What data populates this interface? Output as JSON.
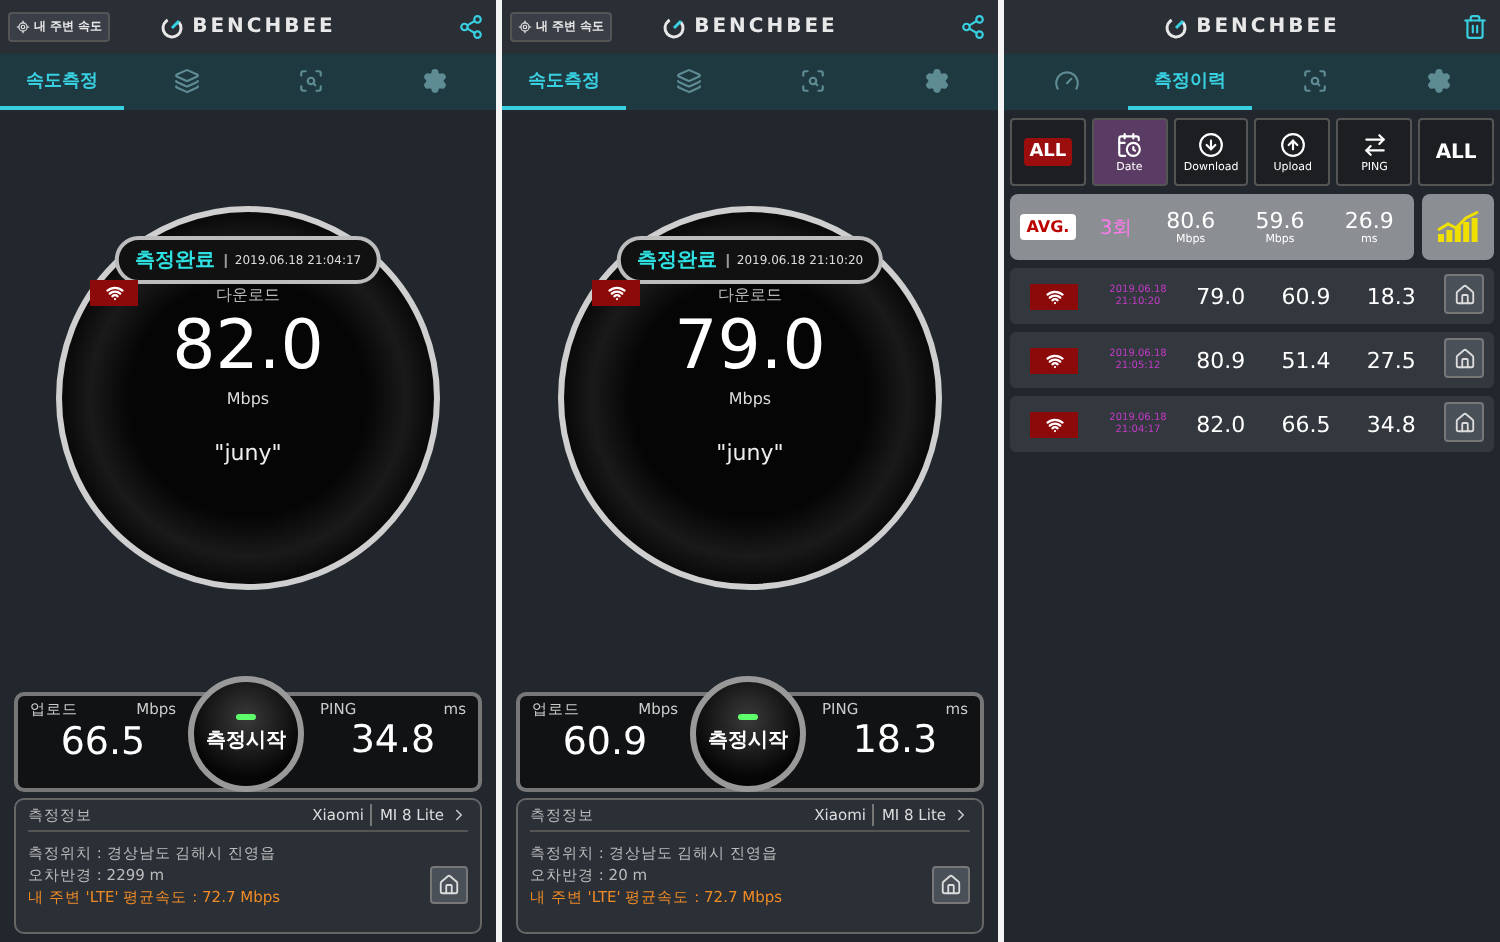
{
  "screens": [
    {
      "kind": "result",
      "header": {
        "nearby_button": "내 주변 속도",
        "logo": "BENCHBEE"
      },
      "tabs": [
        {
          "kind": "text",
          "label": "속도측정",
          "selected": true
        },
        {
          "kind": "layers",
          "selected": false
        },
        {
          "kind": "history",
          "selected": false
        },
        {
          "kind": "settings",
          "selected": false
        }
      ],
      "dial": {
        "status": "측정완료",
        "timestamp": "2019.06.18 21:04:17",
        "label": "다운로드",
        "value": "82.0",
        "unit": "Mbps",
        "network_name": "\"juny\""
      },
      "stats": {
        "upload_label": "업로드",
        "upload_unit": "Mbps",
        "upload_value": "66.5",
        "start_button": "측정시작",
        "ping_label": "PING",
        "ping_unit": "ms",
        "ping_value": "34.8"
      },
      "info": {
        "title": "측정정보",
        "brand": "Xiaomi",
        "model": "MI 8 Lite",
        "location": "측정위치 : 경상남도 김해시  진영읍",
        "radius": "오차반경 : 2299 m",
        "average": "내 주변 'LTE' 평균속도 :  72.7 Mbps"
      }
    },
    {
      "kind": "result",
      "header": {
        "nearby_button": "내 주변 속도",
        "logo": "BENCHBEE"
      },
      "tabs": [
        {
          "kind": "text",
          "label": "속도측정",
          "selected": true
        },
        {
          "kind": "layers",
          "selected": false
        },
        {
          "kind": "history",
          "selected": false
        },
        {
          "kind": "settings",
          "selected": false
        }
      ],
      "dial": {
        "status": "측정완료",
        "timestamp": "2019.06.18 21:10:20",
        "label": "다운로드",
        "value": "79.0",
        "unit": "Mbps",
        "network_name": "\"juny\""
      },
      "stats": {
        "upload_label": "업로드",
        "upload_unit": "Mbps",
        "upload_value": "60.9",
        "start_button": "측정시작",
        "ping_label": "PING",
        "ping_unit": "ms",
        "ping_value": "18.3"
      },
      "info": {
        "title": "측정정보",
        "brand": "Xiaomi",
        "model": "MI 8 Lite",
        "location": "측정위치 : 경상남도 김해시  진영읍",
        "radius": "오차반경 : 20 m",
        "average": "내 주변 'LTE' 평균속도 :  72.7 Mbps"
      }
    },
    {
      "kind": "history",
      "header": {
        "logo": "BENCHBEE"
      },
      "tabs": [
        {
          "kind": "gauge",
          "selected": false
        },
        {
          "kind": "text",
          "label": "측정이력",
          "selected": true
        },
        {
          "kind": "history",
          "selected": false
        },
        {
          "kind": "settings",
          "selected": false
        }
      ],
      "filters": [
        {
          "kind": "badge",
          "label": "ALL",
          "selected": false
        },
        {
          "kind": "date",
          "label": "Date",
          "selected": true
        },
        {
          "kind": "download",
          "label": "Download",
          "selected": false
        },
        {
          "kind": "upload",
          "label": "Upload",
          "selected": false
        },
        {
          "kind": "ping",
          "label": "PING",
          "selected": false
        },
        {
          "kind": "plain",
          "label": "ALL",
          "selected": false
        }
      ],
      "average": {
        "badge": "AVG.",
        "count": "3회",
        "download": "80.6",
        "download_unit": "Mbps",
        "upload": "59.6",
        "upload_unit": "Mbps",
        "ping": "26.9",
        "ping_unit": "ms"
      },
      "rows": [
        {
          "date": "2019.06.18",
          "time": "21:10:20",
          "download": "79.0",
          "upload": "60.9",
          "ping": "18.3"
        },
        {
          "date": "2019.06.18",
          "time": "21:05:12",
          "download": "80.9",
          "upload": "51.4",
          "ping": "27.5"
        },
        {
          "date": "2019.06.18",
          "time": "21:04:17",
          "download": "82.0",
          "upload": "66.5",
          "ping": "34.8"
        }
      ]
    }
  ]
}
